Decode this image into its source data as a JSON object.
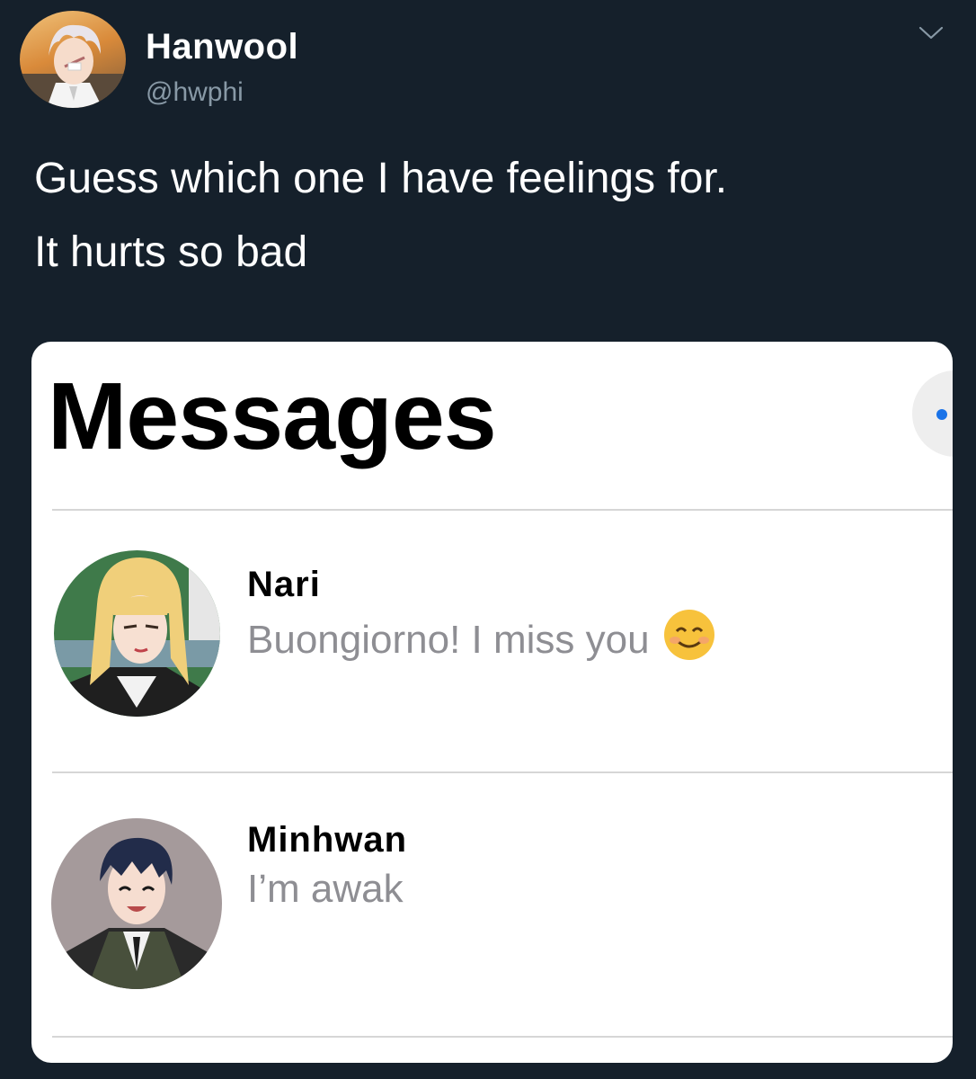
{
  "tweet": {
    "author": {
      "display_name": "Hanwool",
      "handle": "@hwphi",
      "avatar_icon": "anime-boy-avatar"
    },
    "text_lines": [
      "Guess which one I have feelings for.",
      "It hurts so bad"
    ],
    "menu_icon": "chevron-down-icon"
  },
  "messages_screenshot": {
    "title": "Messages",
    "compose_dot_color": "#1a73e8",
    "conversations": [
      {
        "name": "Nari",
        "preview": "Buongiorno! I miss you",
        "emoji_icon": "smiling-face-emoji"
      },
      {
        "name": "Minhwan",
        "preview": "I’m awak"
      }
    ]
  },
  "colors": {
    "background": "#15202b",
    "secondary_text": "#8899a6",
    "preview_text": "#8e8e93"
  }
}
